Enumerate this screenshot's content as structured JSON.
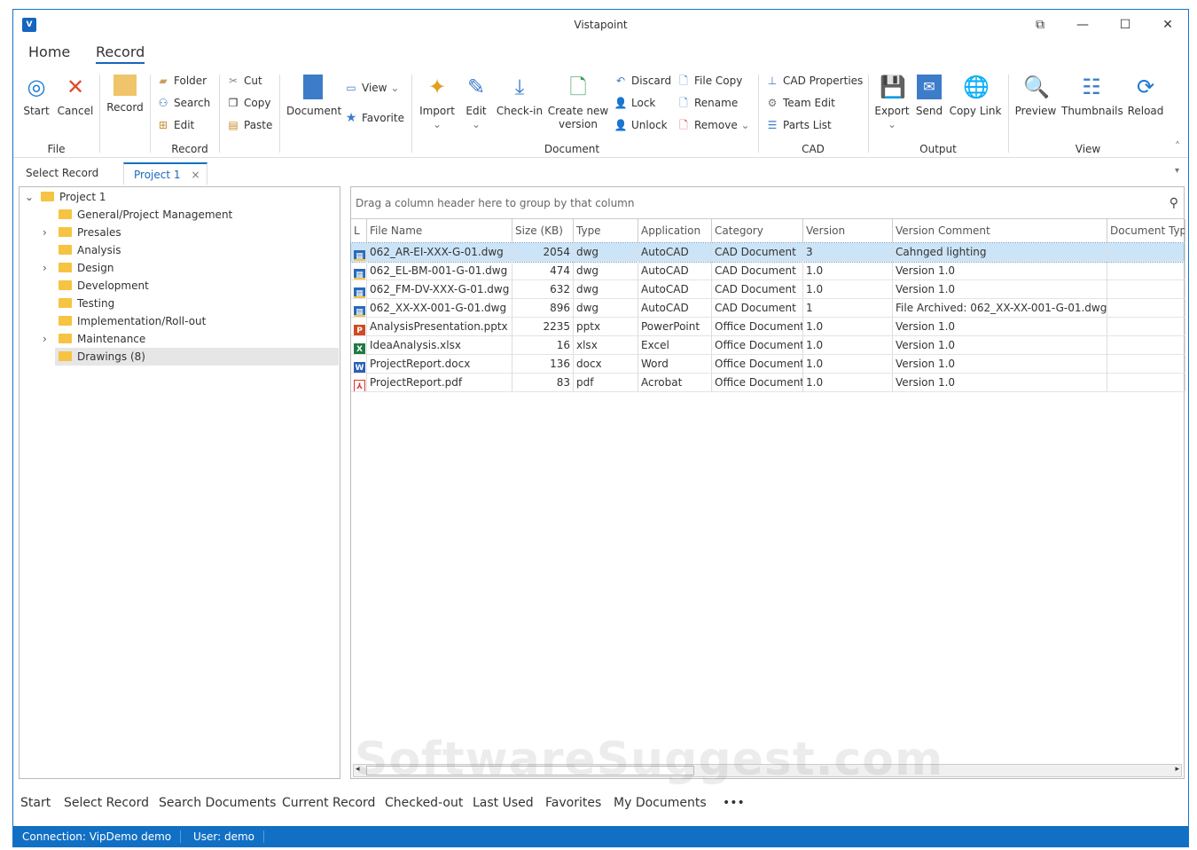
{
  "window": {
    "title": "Vistapoint",
    "controls": [
      "⧉",
      "—",
      "☐",
      "✕"
    ]
  },
  "ribbon_tabs": [
    {
      "label": "Home"
    },
    {
      "label": "Record",
      "active": true
    }
  ],
  "ribbon": {
    "start": "Start",
    "cancel": "Cancel",
    "record": "Record",
    "folder": "Folder",
    "search": "Search",
    "edit_rec": "Edit",
    "cut": "Cut",
    "copy": "Copy",
    "paste": "Paste",
    "document": "Document",
    "view": "View",
    "favorite": "Favorite",
    "import": "Import",
    "edit": "Edit",
    "checkin": "Check-in",
    "create_new_1": "Create new",
    "create_new_2": "version",
    "discard": "Discard",
    "lock": "Lock",
    "unlock": "Unlock",
    "file_copy": "File Copy",
    "rename": "Rename",
    "remove": "Remove",
    "cad_properties": "CAD Properties",
    "team_edit": "Team Edit",
    "parts_list": "Parts List",
    "export": "Export",
    "send": "Send",
    "copy_link": "Copy Link",
    "preview": "Preview",
    "thumbnails": "Thumbnails",
    "reload": "Reload",
    "groups": {
      "file": "File",
      "record": "Record",
      "document": "Document",
      "cad": "CAD",
      "output": "Output",
      "view": "View"
    }
  },
  "doc_tabs": {
    "select_record": "Select Record",
    "project": "Project 1",
    "close": "×"
  },
  "tree": [
    {
      "label": "Project 1",
      "level": 0,
      "expander": "⌄"
    },
    {
      "label": "General/Project Management",
      "level": 1,
      "expander": ""
    },
    {
      "label": "Presales",
      "level": 1,
      "expander": "›"
    },
    {
      "label": "Analysis",
      "level": 1,
      "expander": ""
    },
    {
      "label": "Design",
      "level": 1,
      "expander": "›"
    },
    {
      "label": "Development",
      "level": 1,
      "expander": ""
    },
    {
      "label": "Testing",
      "level": 1,
      "expander": ""
    },
    {
      "label": "Implementation/Roll-out",
      "level": 1,
      "expander": ""
    },
    {
      "label": "Maintenance",
      "level": 1,
      "expander": "›"
    },
    {
      "label": "Drawings (8)",
      "level": 1,
      "expander": "",
      "selected": true
    }
  ],
  "grid": {
    "group_hint": "Drag a column header here to group by that column",
    "columns": [
      "L",
      "File Name",
      "Size (KB)",
      "Type",
      "Application",
      "Category",
      "Version",
      "Version Comment",
      "Document Typ"
    ],
    "rows": [
      {
        "icon": "dwg",
        "name": "062_AR-EI-XXX-G-01.dwg",
        "size": "2054",
        "type": "dwg",
        "app": "AutoCAD",
        "cat": "CAD Document",
        "ver": "3",
        "comment": "Cahnged lighting",
        "selected": true
      },
      {
        "icon": "dwg",
        "name": "062_EL-BM-001-G-01.dwg",
        "size": "474",
        "type": "dwg",
        "app": "AutoCAD",
        "cat": "CAD Document",
        "ver": "1.0",
        "comment": "Version 1.0"
      },
      {
        "icon": "dwg",
        "name": "062_FM-DV-XXX-G-01.dwg",
        "size": "632",
        "type": "dwg",
        "app": "AutoCAD",
        "cat": "CAD Document",
        "ver": "1.0",
        "comment": "Version 1.0"
      },
      {
        "icon": "dwg",
        "name": "062_XX-XX-001-G-01.dwg",
        "size": "896",
        "type": "dwg",
        "app": "AutoCAD",
        "cat": "CAD Document",
        "ver": "1",
        "comment": "File Archived: 062_XX-XX-001-G-01.dwg"
      },
      {
        "icon": "pptx",
        "name": "AnalysisPresentation.pptx",
        "size": "2235",
        "type": "pptx",
        "app": "PowerPoint",
        "cat": "Office Document",
        "ver": "1.0",
        "comment": "Version 1.0"
      },
      {
        "icon": "xlsx",
        "name": "IdeaAnalysis.xlsx",
        "size": "16",
        "type": "xlsx",
        "app": "Excel",
        "cat": "Office Document",
        "ver": "1.0",
        "comment": "Version 1.0"
      },
      {
        "icon": "docx",
        "name": "ProjectReport.docx",
        "size": "136",
        "type": "docx",
        "app": "Word",
        "cat": "Office Document",
        "ver": "1.0",
        "comment": "Version 1.0"
      },
      {
        "icon": "pdf",
        "name": "ProjectReport.pdf",
        "size": "83",
        "type": "pdf",
        "app": "Acrobat",
        "cat": "Office Document",
        "ver": "1.0",
        "comment": "Version 1.0"
      }
    ]
  },
  "bottom_nav": [
    "Start",
    "Select Record",
    "Search Documents",
    "Current Record",
    "Checked-out",
    "Last Used",
    "Favorites",
    "My Documents",
    "•••"
  ],
  "status": {
    "connection": "Connection: VipDemo demo",
    "user": "User: demo"
  },
  "watermark": "SoftwareSuggest.com",
  "colors": {
    "accent": "#1170c4",
    "selected_row": "#cce4f7",
    "tree_selected": "#e6e6e6"
  }
}
